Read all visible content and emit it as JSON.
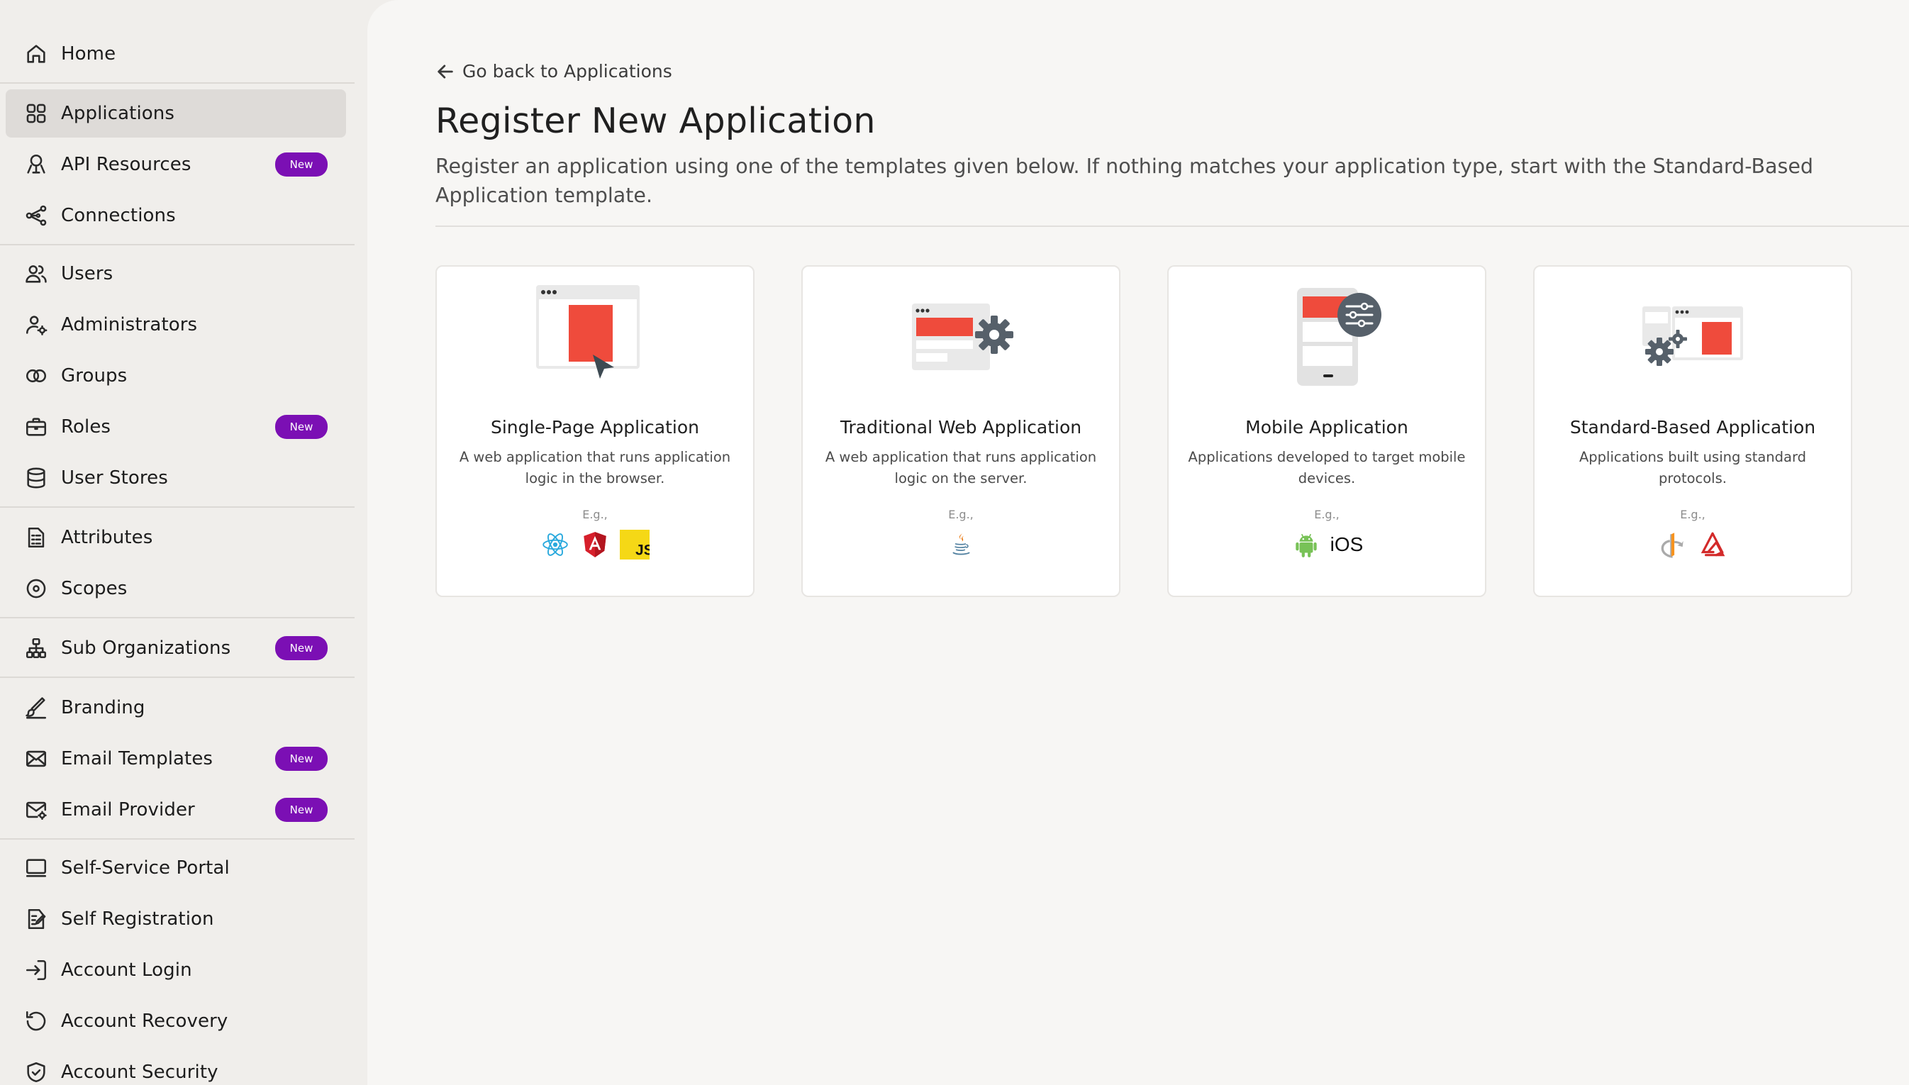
{
  "sidebar": {
    "items": [
      {
        "label": "Home",
        "icon": "home-icon"
      },
      {
        "label": "Applications",
        "icon": "applications-grid-icon",
        "active": true
      },
      {
        "label": "API Resources",
        "icon": "api-resources-icon",
        "badge": "New"
      },
      {
        "label": "Connections",
        "icon": "connections-icon"
      },
      {
        "label": "Users",
        "icon": "users-icon"
      },
      {
        "label": "Administrators",
        "icon": "administrators-icon"
      },
      {
        "label": "Groups",
        "icon": "groups-icon"
      },
      {
        "label": "Roles",
        "icon": "roles-icon",
        "badge": "New"
      },
      {
        "label": "User Stores",
        "icon": "database-icon"
      },
      {
        "label": "Attributes",
        "icon": "attributes-icon"
      },
      {
        "label": "Scopes",
        "icon": "scopes-icon"
      },
      {
        "label": "Sub Organizations",
        "icon": "sub-organizations-icon",
        "badge": "New"
      },
      {
        "label": "Branding",
        "icon": "branding-brush-icon"
      },
      {
        "label": "Email Templates",
        "icon": "email-templates-icon",
        "badge": "New"
      },
      {
        "label": "Email Provider",
        "icon": "email-provider-icon",
        "badge": "New"
      },
      {
        "label": "Self-Service Portal",
        "icon": "monitor-icon"
      },
      {
        "label": "Self Registration",
        "icon": "self-registration-icon"
      },
      {
        "label": "Account Login",
        "icon": "login-icon"
      },
      {
        "label": "Account Recovery",
        "icon": "recovery-icon"
      },
      {
        "label": "Account Security",
        "icon": "shield-icon"
      }
    ]
  },
  "main": {
    "back_link": "Go back to Applications",
    "title": "Register New Application",
    "description": "Register an application using one of the templates given below. If nothing matches your application type, start with the Standard-Based Application template.",
    "cards": [
      {
        "title": "Single-Page Application",
        "description": "A web application that runs application logic in the browser.",
        "eg": "E.g.,",
        "tech": [
          "react-icon",
          "angular-icon",
          "javascript-icon"
        ]
      },
      {
        "title": "Traditional Web Application",
        "description": "A web application that runs application logic on the server.",
        "eg": "E.g.,",
        "tech": [
          "java-icon"
        ]
      },
      {
        "title": "Mobile Application",
        "description": "Applications developed to target mobile devices.",
        "eg": "E.g.,",
        "tech": [
          "android-icon"
        ],
        "tech_text": "iOS"
      },
      {
        "title": "Standard-Based Application",
        "description": "Applications built using standard protocols.",
        "eg": "E.g.,",
        "tech": [
          "openid-icon",
          "saml-icon"
        ]
      }
    ]
  },
  "colors": {
    "accent_red": "#ef4b3c",
    "badge_purple": "#7b0fb4",
    "active_bg": "#dedbd8"
  }
}
